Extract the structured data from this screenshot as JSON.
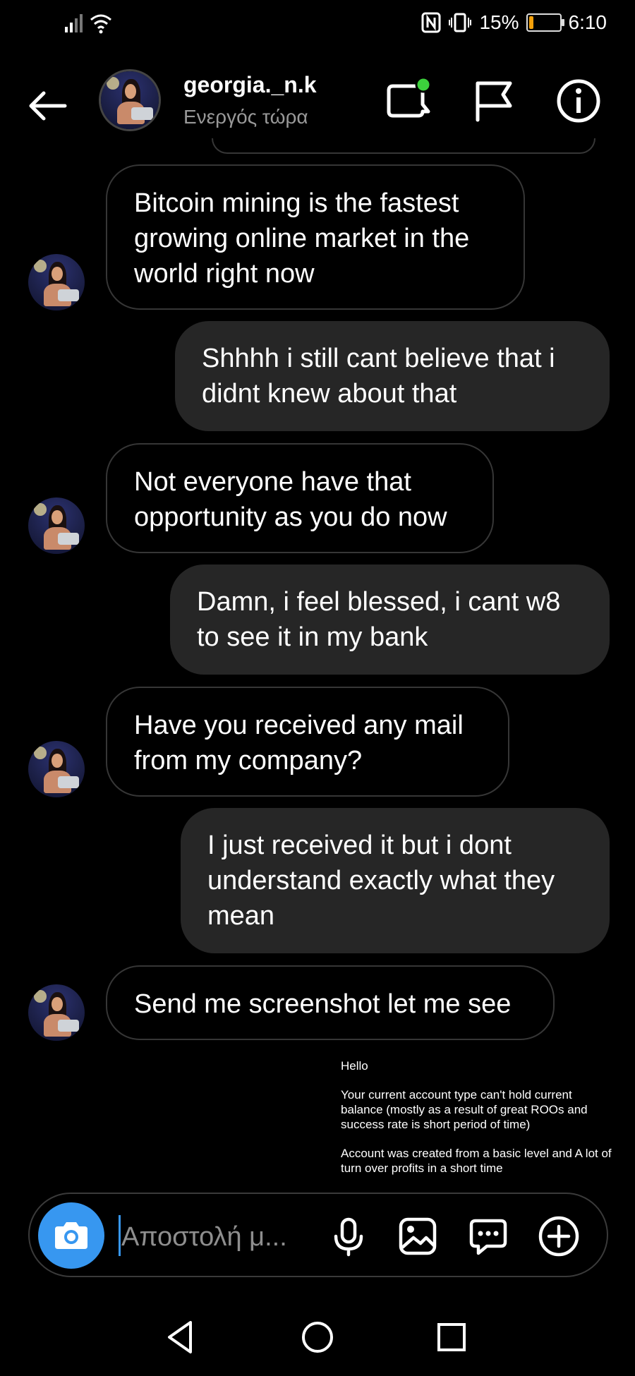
{
  "status_bar": {
    "battery_percent": "15%",
    "battery_level": 0.15,
    "time": "6:10",
    "icons": [
      "signal-icon",
      "wifi-icon",
      "nfc-icon",
      "vibrate-icon",
      "battery-icon"
    ]
  },
  "header": {
    "username": "georgia._n.k",
    "status": "Ενεργός τώρα",
    "icons": [
      "back-arrow-icon",
      "video-call-icon",
      "flag-icon",
      "info-icon"
    ]
  },
  "messages": [
    {
      "direction": "in",
      "text": "Bitcoin mining is the fastest growing online market in the world right now"
    },
    {
      "direction": "out",
      "text": "Shhhh i still cant believe that i didnt knew about that"
    },
    {
      "direction": "in",
      "text": "Not everyone have that opportunity as you do now"
    },
    {
      "direction": "out",
      "text": "Damn, i feel blessed, i cant w8 to see it in my bank"
    },
    {
      "direction": "in",
      "text": "Have you received any mail from my company?"
    },
    {
      "direction": "out",
      "text": "I just received it but i dont understand exactly what they mean"
    },
    {
      "direction": "in",
      "text": "Send me screenshot let me see"
    }
  ],
  "screenshot_preview": {
    "lines": [
      "Hello",
      "Your current account type can't hold current balance (mostly as a result of great ROOs and success rate is short period of time)",
      "Account was created from a basic level and A lot of turn over profits in a short time"
    ]
  },
  "composer": {
    "placeholder": "Αποστολή μ...",
    "icons": [
      "camera-icon",
      "microphone-icon",
      "gallery-icon",
      "sticker-icon",
      "plus-icon"
    ]
  },
  "nav_bar": {
    "icons": [
      "nav-back-icon",
      "nav-home-icon",
      "nav-recents-icon"
    ]
  },
  "colors": {
    "background": "#000000",
    "incoming_border": "#363636",
    "outgoing_bubble": "#262626",
    "accent_blue": "#3797f0",
    "online_dot": "#3cd03c",
    "battery_fill": "#f5a10a",
    "secondary_text": "#999999"
  }
}
